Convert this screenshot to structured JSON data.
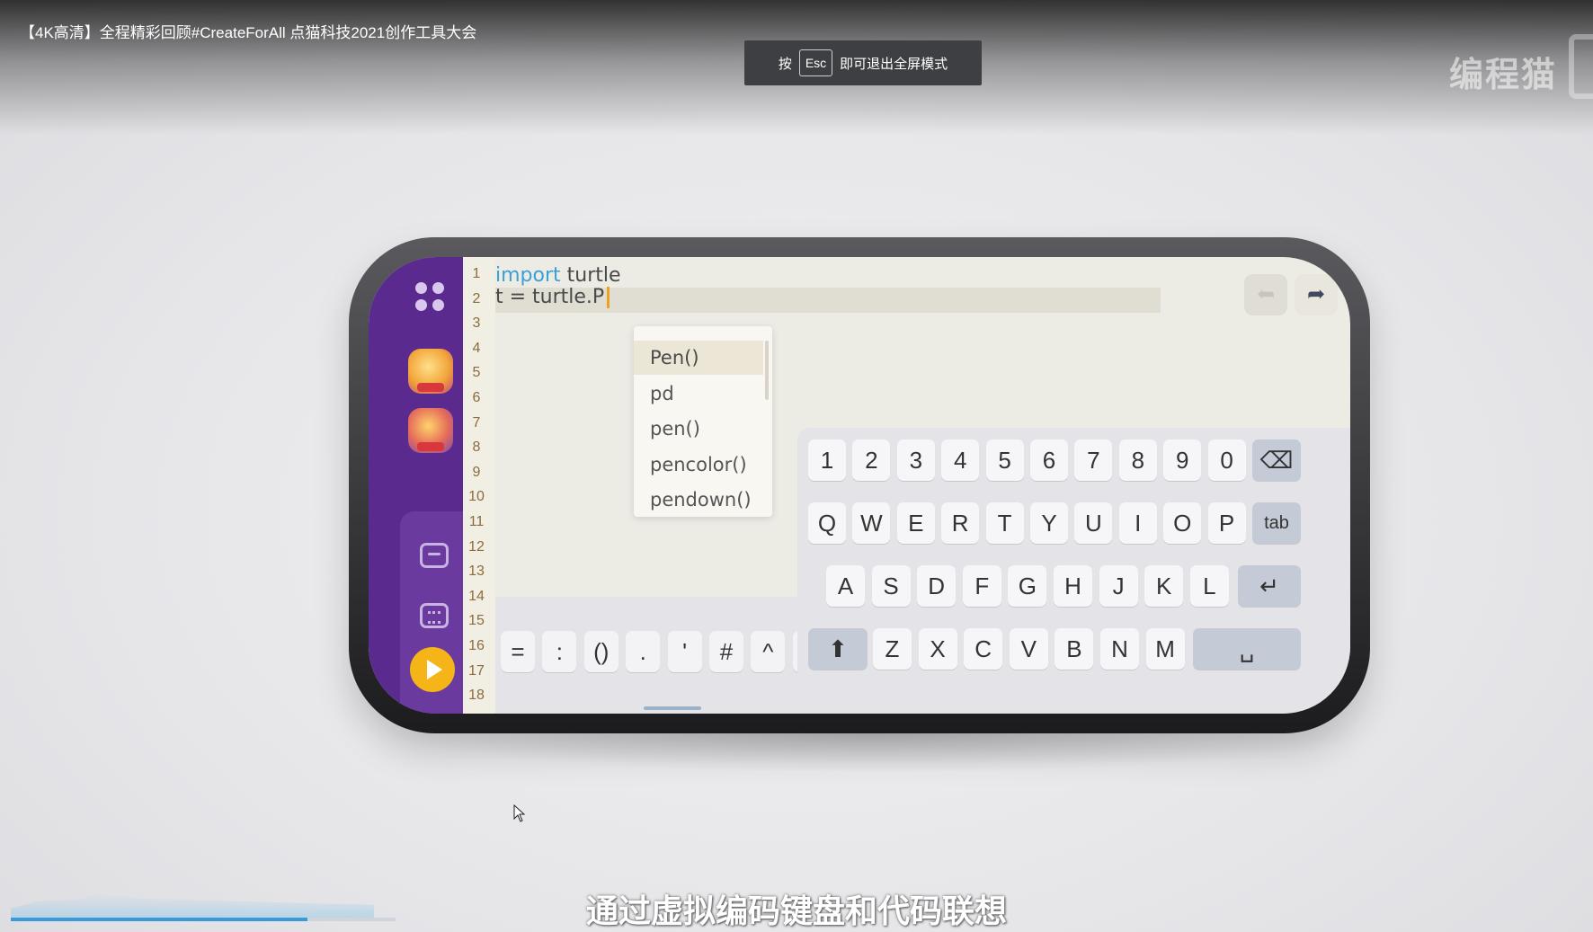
{
  "video": {
    "title": "【4K高清】全程精彩回顾#CreateForAll 点猫科技2021创作工具大会",
    "watermark": "编程猫",
    "subtitle": "通过虚拟编码键盘和代码联想",
    "progress": 0.77
  },
  "fullscreen_toast": {
    "prefix": "按",
    "key": "Esc",
    "suffix": "即可退出全屏模式"
  },
  "editor": {
    "line_numbers": [
      "1",
      "2",
      "3",
      "4",
      "5",
      "6",
      "7",
      "8",
      "9",
      "10",
      "11",
      "12",
      "13",
      "14",
      "15",
      "16",
      "17",
      "18"
    ],
    "line1": {
      "keyword": "import",
      "rest": " turtle"
    },
    "line2": "t = turtle.P"
  },
  "suggestions": [
    "Pen()",
    "pd",
    "pen()",
    "pencolor()",
    "pendown()"
  ],
  "symbols": [
    "=",
    ":",
    "()",
    ".",
    "'",
    "#",
    "^",
    "&"
  ],
  "keyboard": {
    "row1": [
      "1",
      "2",
      "3",
      "4",
      "5",
      "6",
      "7",
      "8",
      "9",
      "0"
    ],
    "row2": [
      "Q",
      "W",
      "E",
      "R",
      "T",
      "Y",
      "U",
      "I",
      "O",
      "P"
    ],
    "tab_label": "tab",
    "row3": [
      "A",
      "S",
      "D",
      "F",
      "G",
      "H",
      "J",
      "K",
      "L"
    ],
    "row4": [
      "Z",
      "X",
      "C",
      "V",
      "B",
      "N",
      "M"
    ],
    "backspace_icon": "⌫",
    "enter_icon": "↵",
    "shift_icon": "⬆",
    "space_icon": "␣"
  },
  "colors": {
    "sidebar": "#5a2a8f",
    "accent": "#f5b518",
    "keyword": "#3aa0d8"
  }
}
